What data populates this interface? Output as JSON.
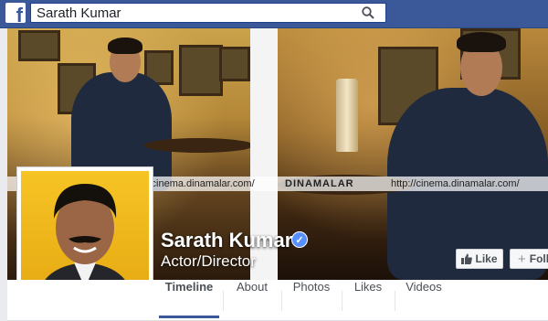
{
  "topbar": {
    "logo_letter": "f",
    "search_value": "Sarath Kumar",
    "search_icon": "search-icon"
  },
  "watermark": {
    "brand": "DINAMALAR",
    "url": "http://cinema.dinamalar.com/"
  },
  "profile": {
    "name": "Sarath Kumar",
    "subtitle": "Actor/Director",
    "verified_icon": "check-icon"
  },
  "actions": {
    "like_label": "Like",
    "follow_label": "Follow"
  },
  "tabs": [
    {
      "label": "Timeline",
      "active": true
    },
    {
      "label": "About"
    },
    {
      "label": "Photos"
    },
    {
      "label": "Likes"
    },
    {
      "label": "Videos"
    }
  ],
  "colors": {
    "brand": "#3b5998",
    "verified": "#5890ff"
  }
}
